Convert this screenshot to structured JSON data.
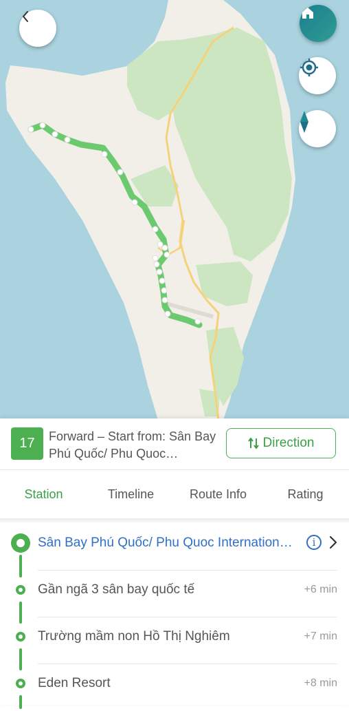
{
  "map": {
    "colors": {
      "sea": "#aad3df",
      "land": "#f2efe9",
      "park": "#cde6c2",
      "route": "#5cc560",
      "road": "#f5d27a"
    },
    "icons": [
      "back-icon",
      "home-icon",
      "locate-icon",
      "compass-icon"
    ]
  },
  "route": {
    "number": "17",
    "title": "Forward – Start from: Sân Bay Phú Quốc/ Phu Quoc International Airport",
    "direction_label": "Direction"
  },
  "tabs": [
    {
      "label": "Station",
      "active": true
    },
    {
      "label": "Timeline",
      "active": false
    },
    {
      "label": "Route Info",
      "active": false
    },
    {
      "label": "Rating",
      "active": false
    }
  ],
  "stops": [
    {
      "name": "Sân Bay Phú Quốc/ Phu Quoc International Airport",
      "time": ""
    },
    {
      "name": "Gần ngã 3 sân bay quốc tế",
      "time": "+6 min"
    },
    {
      "name": "Trường mầm non Hồ Thị Nghiêm",
      "time": "+7 min"
    },
    {
      "name": "Eden Resort",
      "time": "+8 min"
    }
  ],
  "accent": "#4caf50"
}
